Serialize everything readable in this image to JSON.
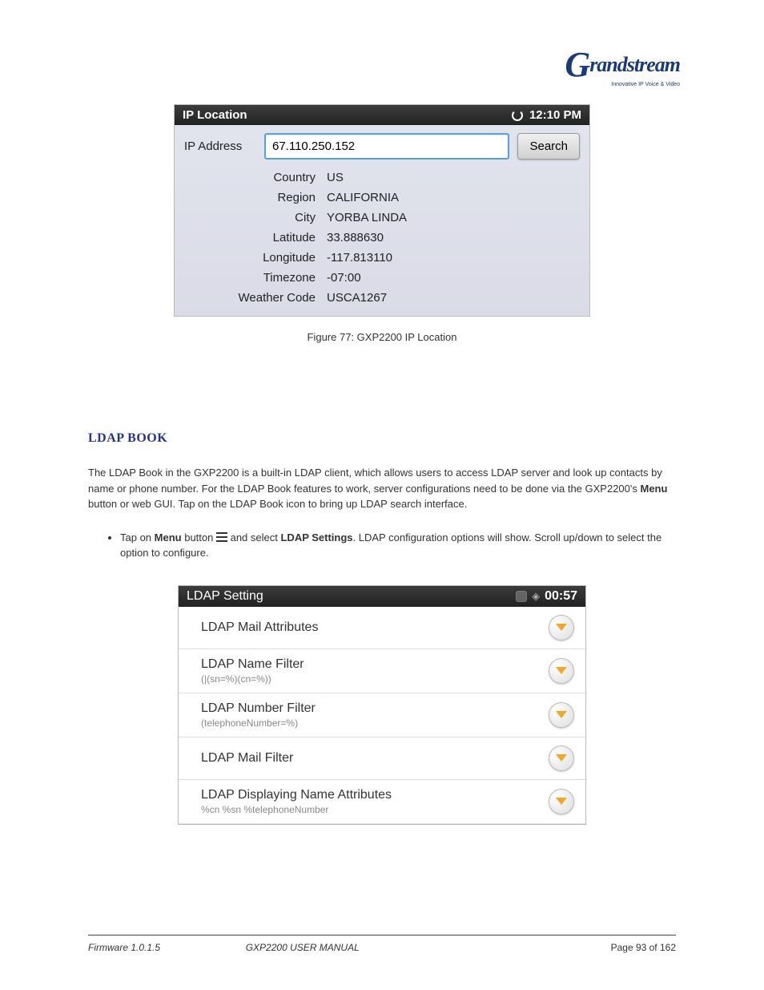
{
  "logo": {
    "text": "Grandstream",
    "tagline": "Innovative IP Voice & Video"
  },
  "screenshot1": {
    "title": "IP Location",
    "time": "12:10 PM",
    "input_label": "IP Address",
    "input_value": "67.110.250.152",
    "search_btn": "Search",
    "rows": [
      {
        "k": "Country",
        "v": "US"
      },
      {
        "k": "Region",
        "v": "CALIFORNIA"
      },
      {
        "k": "City",
        "v": "YORBA LINDA"
      },
      {
        "k": "Latitude",
        "v": "33.888630"
      },
      {
        "k": "Longitude",
        "v": "-117.813110"
      },
      {
        "k": "Timezone",
        "v": "-07:00"
      },
      {
        "k": "Weather Code",
        "v": "USCA1267"
      }
    ]
  },
  "caption1": "Figure 77: GXP2200 IP Location",
  "section_head": "LDAP BOOK",
  "para1_a": "The LDAP Book in the GXP2200 is a built-in LDAP client, which allows users to access LDAP server and look up contacts by name or phone number. For the LDAP Book features to work, server configurations need to be done via the GXP2200's ",
  "para1_b": "Menu",
  "para1_c": " button or web GUI. Tap on the LDAP Book icon to bring up LDAP search interface.",
  "bullet_a": "Tap on ",
  "bullet_b": "Menu",
  "bullet_c": " button ",
  "bullet_d": " and select ",
  "bullet_e": "LDAP Settings",
  "bullet_f": ". LDAP configuration options will show. Scroll up/down to select the option to configure.",
  "screenshot2": {
    "title": "LDAP Setting",
    "time": "00:57",
    "items": [
      {
        "title": "LDAP Mail Attributes",
        "sub": ""
      },
      {
        "title": "LDAP Name Filter",
        "sub": "(|(sn=%)(cn=%))"
      },
      {
        "title": "LDAP Number Filter",
        "sub": "(telephoneNumber=%)"
      },
      {
        "title": "LDAP Mail Filter",
        "sub": ""
      },
      {
        "title": "LDAP Displaying Name Attributes",
        "sub": "%cn %sn %telephoneNumber"
      }
    ]
  },
  "footer": {
    "left_a": "Firmware 1.0.1.5",
    "left_b": "GXP2200 USER MANUAL",
    "right": "Page 93 of 162"
  }
}
